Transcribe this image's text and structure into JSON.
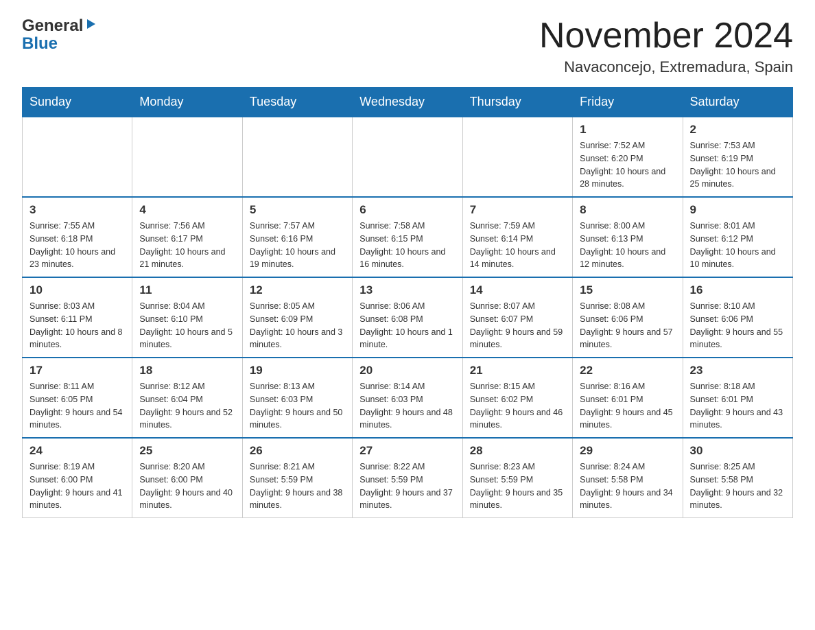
{
  "logo": {
    "general": "General",
    "blue": "Blue"
  },
  "header": {
    "month": "November 2024",
    "location": "Navaconcejo, Extremadura, Spain"
  },
  "weekdays": [
    "Sunday",
    "Monday",
    "Tuesday",
    "Wednesday",
    "Thursday",
    "Friday",
    "Saturday"
  ],
  "weeks": [
    [
      {
        "day": "",
        "info": ""
      },
      {
        "day": "",
        "info": ""
      },
      {
        "day": "",
        "info": ""
      },
      {
        "day": "",
        "info": ""
      },
      {
        "day": "",
        "info": ""
      },
      {
        "day": "1",
        "info": "Sunrise: 7:52 AM\nSunset: 6:20 PM\nDaylight: 10 hours and 28 minutes."
      },
      {
        "day": "2",
        "info": "Sunrise: 7:53 AM\nSunset: 6:19 PM\nDaylight: 10 hours and 25 minutes."
      }
    ],
    [
      {
        "day": "3",
        "info": "Sunrise: 7:55 AM\nSunset: 6:18 PM\nDaylight: 10 hours and 23 minutes."
      },
      {
        "day": "4",
        "info": "Sunrise: 7:56 AM\nSunset: 6:17 PM\nDaylight: 10 hours and 21 minutes."
      },
      {
        "day": "5",
        "info": "Sunrise: 7:57 AM\nSunset: 6:16 PM\nDaylight: 10 hours and 19 minutes."
      },
      {
        "day": "6",
        "info": "Sunrise: 7:58 AM\nSunset: 6:15 PM\nDaylight: 10 hours and 16 minutes."
      },
      {
        "day": "7",
        "info": "Sunrise: 7:59 AM\nSunset: 6:14 PM\nDaylight: 10 hours and 14 minutes."
      },
      {
        "day": "8",
        "info": "Sunrise: 8:00 AM\nSunset: 6:13 PM\nDaylight: 10 hours and 12 minutes."
      },
      {
        "day": "9",
        "info": "Sunrise: 8:01 AM\nSunset: 6:12 PM\nDaylight: 10 hours and 10 minutes."
      }
    ],
    [
      {
        "day": "10",
        "info": "Sunrise: 8:03 AM\nSunset: 6:11 PM\nDaylight: 10 hours and 8 minutes."
      },
      {
        "day": "11",
        "info": "Sunrise: 8:04 AM\nSunset: 6:10 PM\nDaylight: 10 hours and 5 minutes."
      },
      {
        "day": "12",
        "info": "Sunrise: 8:05 AM\nSunset: 6:09 PM\nDaylight: 10 hours and 3 minutes."
      },
      {
        "day": "13",
        "info": "Sunrise: 8:06 AM\nSunset: 6:08 PM\nDaylight: 10 hours and 1 minute."
      },
      {
        "day": "14",
        "info": "Sunrise: 8:07 AM\nSunset: 6:07 PM\nDaylight: 9 hours and 59 minutes."
      },
      {
        "day": "15",
        "info": "Sunrise: 8:08 AM\nSunset: 6:06 PM\nDaylight: 9 hours and 57 minutes."
      },
      {
        "day": "16",
        "info": "Sunrise: 8:10 AM\nSunset: 6:06 PM\nDaylight: 9 hours and 55 minutes."
      }
    ],
    [
      {
        "day": "17",
        "info": "Sunrise: 8:11 AM\nSunset: 6:05 PM\nDaylight: 9 hours and 54 minutes."
      },
      {
        "day": "18",
        "info": "Sunrise: 8:12 AM\nSunset: 6:04 PM\nDaylight: 9 hours and 52 minutes."
      },
      {
        "day": "19",
        "info": "Sunrise: 8:13 AM\nSunset: 6:03 PM\nDaylight: 9 hours and 50 minutes."
      },
      {
        "day": "20",
        "info": "Sunrise: 8:14 AM\nSunset: 6:03 PM\nDaylight: 9 hours and 48 minutes."
      },
      {
        "day": "21",
        "info": "Sunrise: 8:15 AM\nSunset: 6:02 PM\nDaylight: 9 hours and 46 minutes."
      },
      {
        "day": "22",
        "info": "Sunrise: 8:16 AM\nSunset: 6:01 PM\nDaylight: 9 hours and 45 minutes."
      },
      {
        "day": "23",
        "info": "Sunrise: 8:18 AM\nSunset: 6:01 PM\nDaylight: 9 hours and 43 minutes."
      }
    ],
    [
      {
        "day": "24",
        "info": "Sunrise: 8:19 AM\nSunset: 6:00 PM\nDaylight: 9 hours and 41 minutes."
      },
      {
        "day": "25",
        "info": "Sunrise: 8:20 AM\nSunset: 6:00 PM\nDaylight: 9 hours and 40 minutes."
      },
      {
        "day": "26",
        "info": "Sunrise: 8:21 AM\nSunset: 5:59 PM\nDaylight: 9 hours and 38 minutes."
      },
      {
        "day": "27",
        "info": "Sunrise: 8:22 AM\nSunset: 5:59 PM\nDaylight: 9 hours and 37 minutes."
      },
      {
        "day": "28",
        "info": "Sunrise: 8:23 AM\nSunset: 5:59 PM\nDaylight: 9 hours and 35 minutes."
      },
      {
        "day": "29",
        "info": "Sunrise: 8:24 AM\nSunset: 5:58 PM\nDaylight: 9 hours and 34 minutes."
      },
      {
        "day": "30",
        "info": "Sunrise: 8:25 AM\nSunset: 5:58 PM\nDaylight: 9 hours and 32 minutes."
      }
    ]
  ]
}
